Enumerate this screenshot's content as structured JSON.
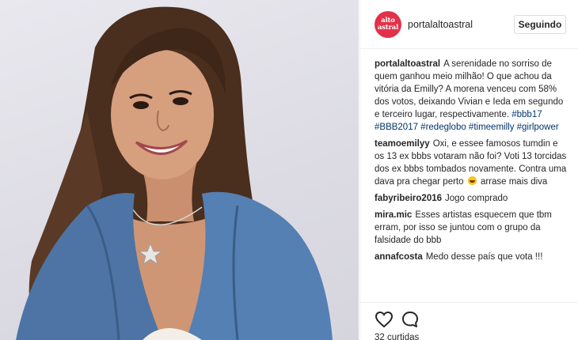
{
  "header": {
    "avatar_text": [
      "alto",
      "astral"
    ],
    "account_name": "portalaltoastral",
    "follow_button": "Seguindo"
  },
  "caption": {
    "user": "portalaltoastral",
    "text": "A serenidade no sorriso de quem ganhou meio milhão! O que achou da vitória da Emilly? A morena venceu com 58% dos votos, deixando Vivian e Ieda em segundo e terceiro lugar, respectivamente.",
    "hashtags": "#bbb17 #BBB2017 #redeglobo #timeemilly #girlpower"
  },
  "comments": [
    {
      "user": "teamoemilyy",
      "text_before": "Oxi, e essee famosos tumdin e os 13 ex bbbs votaram não foi? Voti 13 torcidas dos ex bbbs tombados novamente. Contra uma dava pra chegar perto",
      "text_after": "arrase mais diva"
    },
    {
      "user": "fabyribeiro2016",
      "text": "Jogo comprado"
    },
    {
      "user": "mira.mic",
      "text": "Esses artistas esquecem que tbm erram, por isso se juntou com o grupo da falsidade do bbb"
    },
    {
      "user": "annafcosta",
      "text": "Medo desse país que vota !!!"
    }
  ],
  "actions": {
    "like_icon": "heart-icon",
    "comment_icon": "speech-bubble-icon",
    "likes_text": "32 curtidas"
  },
  "colors": {
    "avatar_bg": "#e2314a",
    "hashtag": "#003569",
    "border": "#efefef"
  }
}
